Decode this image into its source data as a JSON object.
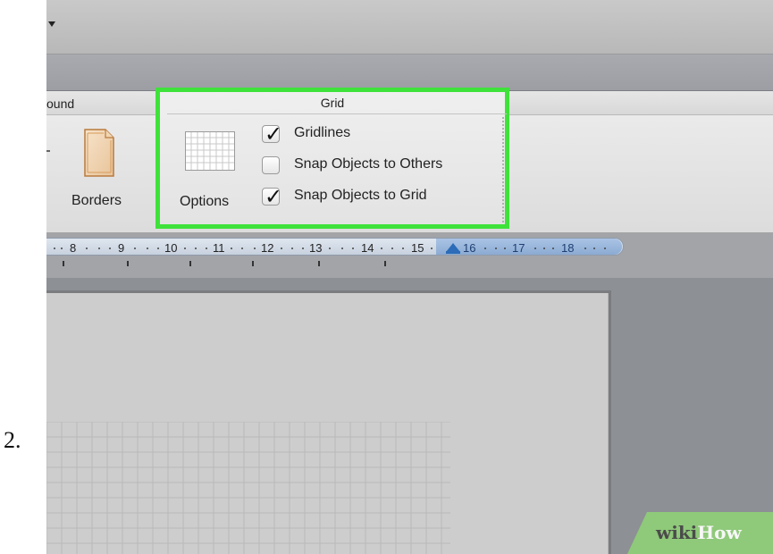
{
  "step": {
    "number": "2."
  },
  "ribbon": {
    "left_group_label": "ound",
    "borders": {
      "label": "Borders",
      "icon": "page-border-icon"
    },
    "grid_group": {
      "title": "Grid",
      "highlight_color": "#3fe23a",
      "options": {
        "label": "Options",
        "icon": "grid-options-icon"
      },
      "checkboxes": [
        {
          "label": "Gridlines",
          "checked": true
        },
        {
          "label": "Snap Objects to Others",
          "checked": false
        },
        {
          "label": "Snap Objects to Grid",
          "checked": true
        }
      ]
    }
  },
  "ruler": {
    "labels": [
      {
        "text": "8",
        "active": false
      },
      {
        "text": "9",
        "active": false
      },
      {
        "text": "10",
        "active": false
      },
      {
        "text": "11",
        "active": false
      },
      {
        "text": "12",
        "active": false
      },
      {
        "text": "13",
        "active": false
      },
      {
        "text": "14",
        "active": false
      },
      {
        "text": "15",
        "active": false
      },
      {
        "text": "16",
        "active": true
      },
      {
        "text": "17",
        "active": true
      },
      {
        "text": "18",
        "active": true
      }
    ],
    "indent_marker_icon": "indent-marker-icon"
  },
  "watermark": {
    "part1": "wiki",
    "part2": "How"
  },
  "colors": {
    "accent_green": "#3fe23a",
    "ruler_active": "#8cabd3",
    "watermark_green": "#8fc97a"
  }
}
